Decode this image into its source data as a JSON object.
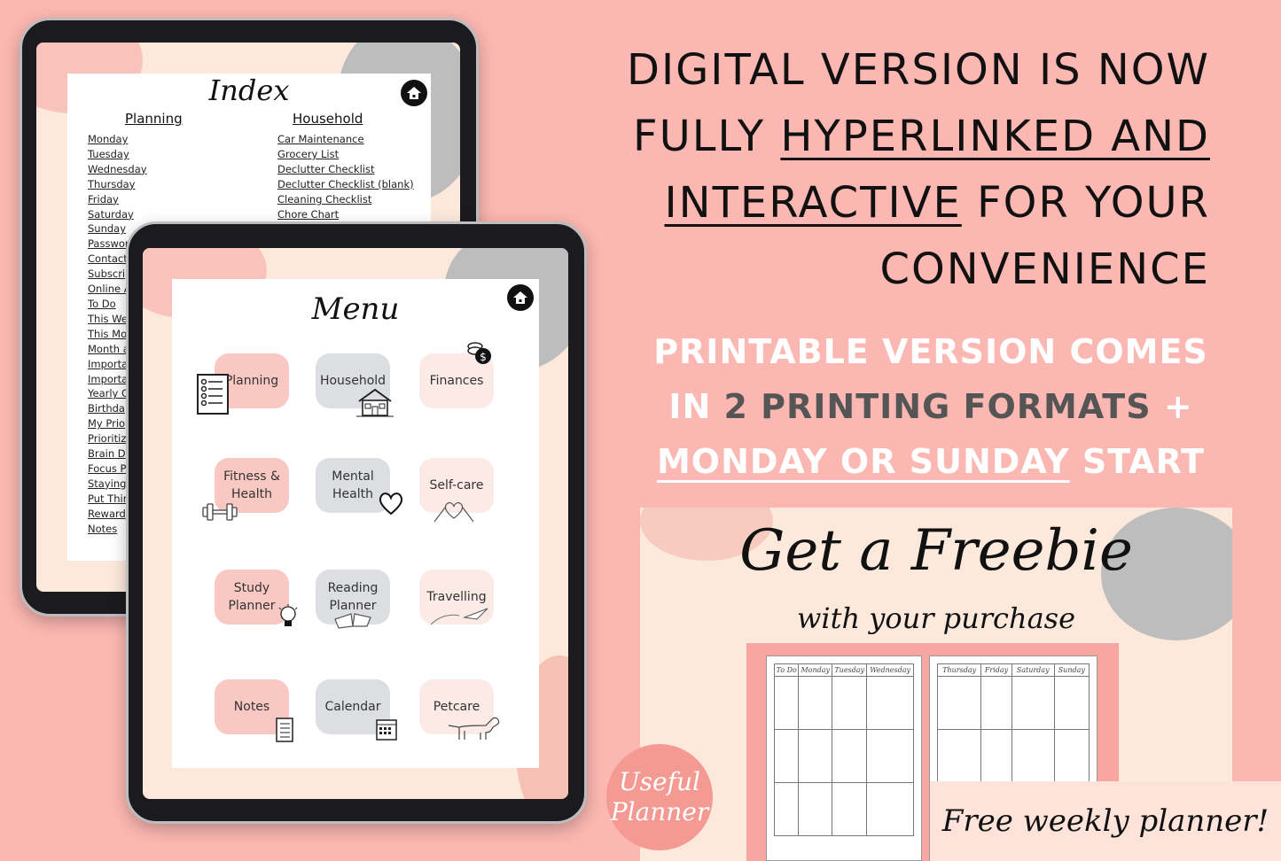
{
  "index_page": {
    "title": "Index",
    "planning_heading": "Planning",
    "household_heading": "Household",
    "planning_links": [
      "Monday",
      "Tuesday",
      "Wednesday",
      "Thursday",
      "Friday",
      "Saturday",
      "Sunday",
      "Passwor",
      "Contact",
      "Subscri",
      "Online A",
      "To Do",
      "This We",
      "This Mo",
      "Month a",
      "Importa",
      "Importa",
      "Yearly C",
      "Birthda",
      "My Prio",
      "Prioritiz",
      "Brain D",
      "Focus P",
      "Staying",
      "Put Thir",
      "Reward",
      "Notes"
    ],
    "household_links": [
      "Car Maintenance",
      "Grocery List",
      "Declutter Checklist",
      "Declutter Checklist (blank)",
      "Cleaning Checklist",
      "Chore Chart"
    ],
    "home_icon": "home-icon"
  },
  "menu_page": {
    "title": "Menu",
    "home_icon": "home-icon",
    "tiles": [
      {
        "label": "Planning",
        "style": "pink",
        "icon": "checklist-icon"
      },
      {
        "label": "Household",
        "style": "grey",
        "icon": "house-icon"
      },
      {
        "label": "Finances",
        "style": "cream",
        "icon": "coins-icon"
      },
      {
        "label": "Fitness & Health",
        "style": "pink",
        "icon": "dumbbell-icon"
      },
      {
        "label": "Mental Health",
        "style": "grey",
        "icon": "heart-icon"
      },
      {
        "label": "Self-care",
        "style": "cream",
        "icon": "heart-hands-icon"
      },
      {
        "label": "Study Planner",
        "style": "pink",
        "icon": "lightbulb-icon"
      },
      {
        "label": "Reading Planner",
        "style": "grey",
        "icon": "book-icon"
      },
      {
        "label": "Travelling",
        "style": "cream",
        "icon": "paper-plane-icon"
      },
      {
        "label": "Notes",
        "style": "pink",
        "icon": "notepad-icon"
      },
      {
        "label": "Calendar",
        "style": "grey",
        "icon": "calendar-icon"
      },
      {
        "label": "Petcare",
        "style": "cream",
        "icon": "dog-icon"
      }
    ]
  },
  "headline": {
    "line1": "DIGITAL VERSION IS NOW",
    "line2_plain": "FULLY ",
    "line2_underlined": "HYPERLINKED AND",
    "line3_underlined": "INTERACTIVE",
    "line3_plain": " FOR YOUR",
    "line4": "CONVENIENCE"
  },
  "subheadline": {
    "line1": "PRINTABLE VERSION COMES",
    "line2_in": "IN ",
    "line2_dark": "2 PRINTING FORMATS",
    "line2_plus": " +",
    "line3_underlined": "MONDAY OR SUNDAY",
    "line3_plain": " START"
  },
  "freebie": {
    "title": "Get a Freebie",
    "subtitle": "with your purchase",
    "left_page_columns": [
      "To Do",
      "Monday",
      "Tuesday",
      "Wednesday"
    ],
    "right_page_columns": [
      "Thursday",
      "Friday",
      "Saturday",
      "Sunday"
    ],
    "caption": "Free weekly planner!"
  },
  "brand": {
    "line1": "Useful",
    "line2": "Planner"
  },
  "colors": {
    "background": "#fbb7b1",
    "tile_pink": "#f9c8c2",
    "tile_grey": "#dcdee1",
    "tile_cream": "#fbeae5",
    "badge": "#f59a92"
  }
}
